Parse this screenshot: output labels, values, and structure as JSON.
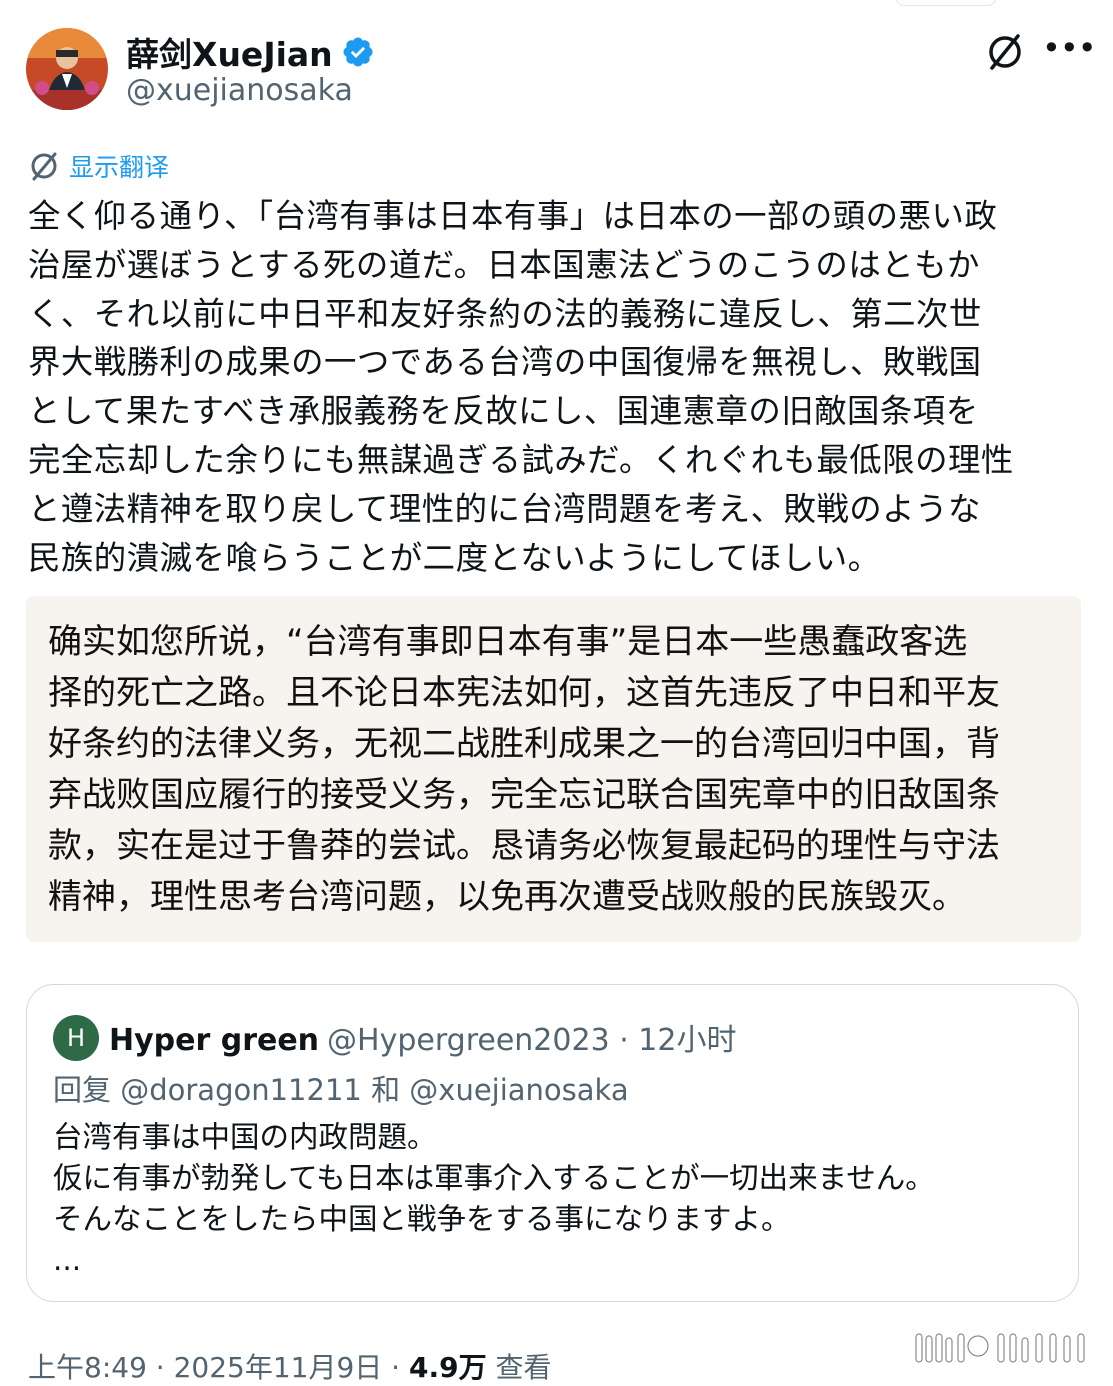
{
  "author": {
    "display_name": "薛剑XueJian",
    "handle": "@xuejianosaka",
    "verified": true
  },
  "icons": {
    "verified": "verified-badge-icon",
    "grok": "grok-icon",
    "more": "more-icon",
    "translate": "translate-icon"
  },
  "translate_label": "显示翻译",
  "tweet_text": "全く仰る通り、「台湾有事は日本有事」は日本の一部の頭の悪い政\n治屋が選ぼうとする死の道だ。日本国憲法どうのこうのはともか\nく、それ以前に中日平和友好条約の法的義務に違反し、第二次世\n界大戦勝利の成果の一つである台湾の中国復帰を無視し、敗戦国\nとして果たすべき承服義務を反故にし、国連憲章の旧敵国条項を\n完全忘却した余りにも無謀過ぎる試みだ。くれぐれも最低限の理性\nと遵法精神を取り戻して理性的に台湾問題を考え、敗戦のような\n民族的潰滅を喰らうことが二度とないようにしてほしい。",
  "translation_text": "确实如您所说，“台湾有事即日本有事”是日本一些愚蠢政客选\n择的死亡之路。且不论日本宪法如何，这首先违反了中日和平友\n好条约的法律义务，无视二战胜利成果之一的台湾回归中国，背\n弃战败国应履行的接受义务，完全忘记联合国宪章中的旧敌国条\n款，实在是过于鲁莽的尝试。恳请务必恢复最起码的理性与守法\n精神，理性思考台湾问题，以免再次遭受战败般的民族毁灭。",
  "quote": {
    "avatar_letter": "H",
    "name": "Hyper green",
    "handle_time": "@Hypergreen2023 · 12小时",
    "reply_to": "回复 @doragon11211 和 @xuejianosaka",
    "body": "台湾有事は中国の内政問題。\n仮に有事が勃発しても日本は軍事介入することが一切出来ません。\nそんなことをしたら中国と戦争をする事になりますよ。\n..."
  },
  "meta": {
    "time_date": "上午8:49 · 2025年11月9日 · ",
    "views_count": "4.9万",
    "views_label": " 查看"
  },
  "colors": {
    "link_blue": "#1d9bf0",
    "verified_blue": "#1d9bf0",
    "secondary_text": "#536471",
    "translation_bg": "#f7f3ef"
  }
}
